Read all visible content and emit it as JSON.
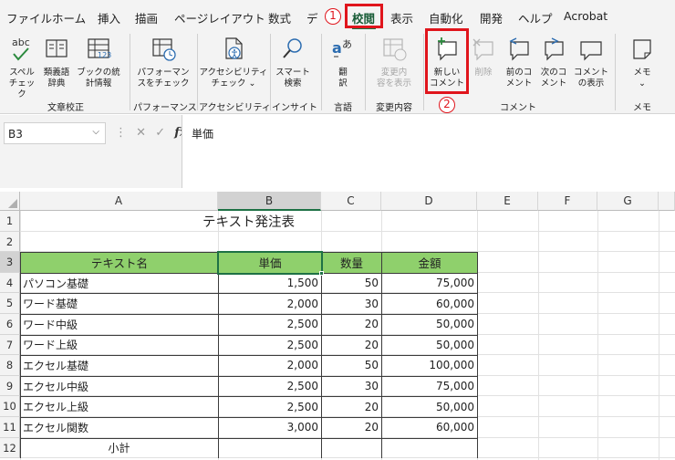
{
  "tabs": [
    "ファイル",
    "ホーム",
    "挿入",
    "描画",
    "ページレイアウト",
    "数式",
    "デ",
    "校閲",
    "表示",
    "自動化",
    "開発",
    "ヘルプ",
    "Acrobat"
  ],
  "active_tab": "校閲",
  "annotations": {
    "step1": "1",
    "step2": "2"
  },
  "ribbon": {
    "buttons": [
      {
        "l1": "スペル",
        "l2": "チェック",
        "icon": "spellcheck-icon"
      },
      {
        "l1": "類義語",
        "l2": "辞典",
        "icon": "thesaurus-icon"
      },
      {
        "l1": "ブックの統",
        "l2": "計情報",
        "icon": "workbook-statistics-icon"
      },
      {
        "l1": "パフォーマン",
        "l2": "スをチェック",
        "icon": "performance-check-icon"
      },
      {
        "l1": "アクセシビリティ",
        "l2": "チェック ⌄",
        "icon": "accessibility-icon"
      },
      {
        "l1": "スマート",
        "l2": "検索",
        "icon": "smart-lookup-icon"
      },
      {
        "l1": "翻",
        "l2": "訳",
        "icon": "translate-icon"
      },
      {
        "l1": "変更内",
        "l2": "容を表示",
        "icon": "show-changes-icon"
      },
      {
        "l1": "新しい",
        "l2": "コメント",
        "icon": "new-comment-icon"
      },
      {
        "l1": "削除",
        "l2": "",
        "icon": "delete-comment-icon"
      },
      {
        "l1": "前のコ",
        "l2": "メント",
        "icon": "previous-comment-icon"
      },
      {
        "l1": "次のコ",
        "l2": "メント",
        "icon": "next-comment-icon"
      },
      {
        "l1": "コメント",
        "l2": "の表示",
        "icon": "show-comments-icon"
      },
      {
        "l1": "メモ",
        "l2": "⌄",
        "icon": "notes-icon"
      }
    ],
    "groups": [
      "文章校正",
      "パフォーマンス",
      "アクセシビリティ",
      "インサイト",
      "言語",
      "変更内容",
      "コメント",
      "メモ"
    ]
  },
  "formula_bar": {
    "name_box": "B3",
    "content": "単価"
  },
  "columns": [
    "A",
    "B",
    "C",
    "D",
    "E",
    "F",
    "G"
  ],
  "rows": [
    "1",
    "2",
    "3",
    "4",
    "5",
    "6",
    "7",
    "8",
    "9",
    "10",
    "11",
    "12"
  ],
  "sheet": {
    "title": "テキスト発注表",
    "headers": [
      "テキスト名",
      "単価",
      "数量",
      "金額"
    ],
    "data": [
      [
        "パソコン基礎",
        "1,500",
        "50",
        "75,000"
      ],
      [
        "ワード基礎",
        "2,000",
        "30",
        "60,000"
      ],
      [
        "ワード中級",
        "2,500",
        "20",
        "50,000"
      ],
      [
        "ワード上級",
        "2,500",
        "20",
        "50,000"
      ],
      [
        "エクセル基礎",
        "2,000",
        "50",
        "100,000"
      ],
      [
        "エクセル中級",
        "2,500",
        "30",
        "75,000"
      ],
      [
        "エクセル上級",
        "2,500",
        "20",
        "50,000"
      ],
      [
        "エクセル関数",
        "3,000",
        "20",
        "60,000"
      ]
    ],
    "subtotal_label": "小計"
  },
  "colors": {
    "accent": "#1e7145",
    "header_fill": "#8fd06c",
    "highlight": "#e0151c"
  }
}
